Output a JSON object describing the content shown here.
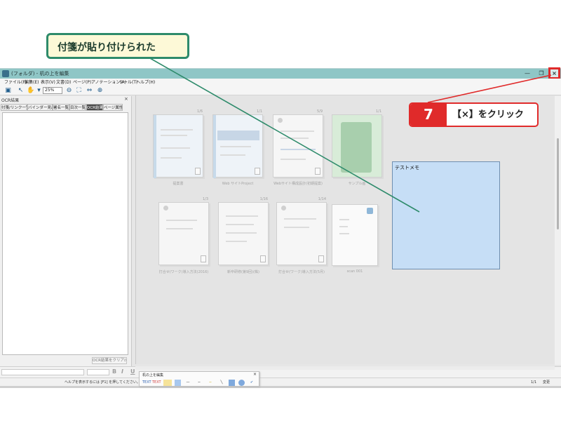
{
  "callout_top": {
    "text": "付箋が貼り付けられた"
  },
  "callout_step": {
    "number": "7",
    "text": "【×】をクリック"
  },
  "window": {
    "title": "(フォルダ) - 机の上を編集",
    "minimize_icon": "minimize-icon",
    "maximize_icon": "restore-icon",
    "close_label": "×"
  },
  "menu": [
    "ファイル(F)",
    "編集(E)",
    "表示(V)",
    "文書(D)",
    "ページ(P)",
    "アノテーション(A)",
    "ツール(T)",
    "ヘルプ(H)"
  ],
  "toolbar": {
    "zoom": "25%"
  },
  "panel": {
    "title": "OCR結果",
    "close": "×",
    "tabs": [
      "付箋/リンク一覧",
      "バインダー見出",
      "署名一覧",
      "目次一覧",
      "OCR結果",
      "ページ属性"
    ],
    "active_tab": 4,
    "ocr_clear_button": "OCR結果をクリア(C)"
  },
  "thumbnails": [
    {
      "page": "1/6",
      "label": "提案書"
    },
    {
      "page": "1/1",
      "label": "Web サイトProject"
    },
    {
      "page": "5/9",
      "label": "Webサイト構成設計(初期提案)"
    },
    {
      "page": "1/1",
      "label": "サンプル画"
    },
    {
      "page": "1/3",
      "label": "打合せ(ワーク)導入方法(2016)"
    },
    {
      "page": "1/16",
      "label": "新卒研修(第9回)(株)"
    },
    {
      "page": "1/14",
      "label": "打合せ(ワーク)導入方法(5月)"
    },
    {
      "page": "",
      "label": "scan 001"
    }
  ],
  "memo": {
    "text": "テストメモ"
  },
  "status": {
    "message": "ヘルプを表示するには [F1] を押してください。",
    "page": "1/1",
    "mode": "変更"
  },
  "palette": {
    "title": "机の上を編集",
    "close": "×",
    "tools": [
      "TEXT",
      "TEXT"
    ]
  },
  "colors": {
    "accent_red": "#e02a2a",
    "callout_green": "#2e8b6b",
    "memo_blue": "#c6def6",
    "titlebar": "#8fc6c6"
  }
}
